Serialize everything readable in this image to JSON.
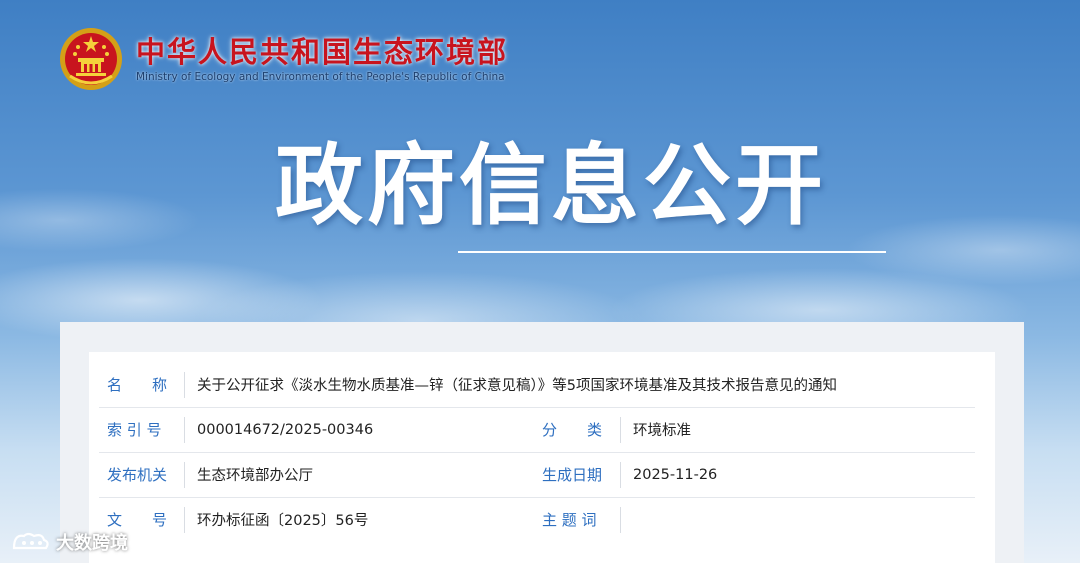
{
  "site": {
    "name_cn": "中华人民共和国生态环境部",
    "name_en": "Ministry of Ecology and Environment of the People's Republic of China",
    "emblem_icon": "national-emblem-icon"
  },
  "hero": {
    "title": "政府信息公开"
  },
  "info": {
    "name_label": "名　　称",
    "name_value": "关于公开征求《淡水生物水质基准—锌（征求意见稿）》等5项国家环境基准及其技术报告意见的通知",
    "index_label": "索 引 号",
    "index_value": "000014672/2025-00346",
    "category_label": "分　　类",
    "category_value": "环境标准",
    "publisher_label": "发布机关",
    "publisher_value": "生态环境部办公厅",
    "date_label": "生成日期",
    "date_value": "2025-11-26",
    "docno_label": "文　　号",
    "docno_value": "环办标征函〔2025〕56号",
    "subject_label": "主 题 词",
    "subject_value": ""
  },
  "watermark": {
    "text": "大数跨境"
  },
  "colors": {
    "brand_red": "#c8141e",
    "label_blue": "#2e6fc0"
  }
}
